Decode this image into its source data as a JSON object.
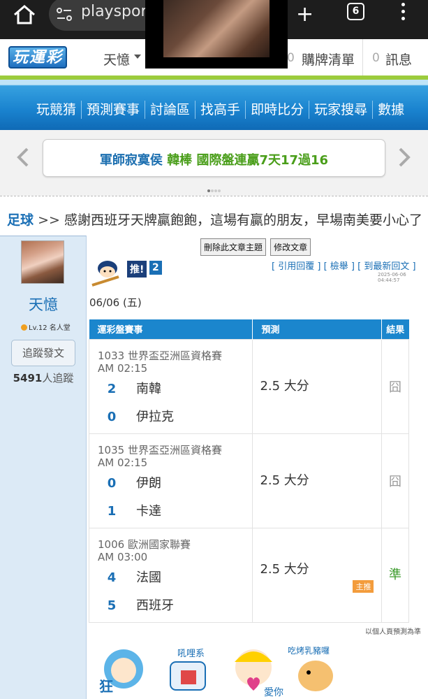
{
  "browser": {
    "url": "playsport",
    "tab_count": "6"
  },
  "header": {
    "logo": "玩運彩",
    "user": "天憶",
    "cart_count": "0",
    "cart_label": "購牌清單",
    "msg_count": "0",
    "msg_label": "訊息"
  },
  "nav": {
    "items": [
      "玩競猜",
      "預測賽事",
      "討論區",
      "找高手",
      "即時比分",
      "玩家搜尋",
      "數據"
    ]
  },
  "banner": {
    "text_a": "軍師寂寞侯",
    "text_b": "韓棒 國際盤連贏7天17過16"
  },
  "title": {
    "category": "足球",
    "separator": ">>",
    "text": "感謝西班牙天牌贏飽飽，這場有贏的朋友，早場南美要小心了"
  },
  "author": {
    "name": "天憶",
    "level": "Lv.12 名人堂",
    "follow_button": "追蹤發文",
    "followers_count": "5491",
    "followers_label": "人追蹤"
  },
  "post": {
    "delete_button": "刪除此文章主題",
    "edit_button": "修改文章",
    "push_label": "推!",
    "push_count": "2",
    "quote_link": "[ 引用回覆 ]",
    "report_link": "[ 檢舉 ]",
    "latest_link": "[ 到最新回文 ]",
    "time": "2025-06-06 04:44:57",
    "date": "06/06 (五)",
    "note": "以個人頁預測為準"
  },
  "table": {
    "headers": [
      "運彩盤賽事",
      "預測",
      "結果"
    ],
    "rows": [
      {
        "league": "1033 世界盃亞洲區資格賽",
        "time": "AM 02:15",
        "team_a_score": "2",
        "team_a": "南韓",
        "team_b_score": "0",
        "team_b": "伊拉克",
        "pick": "2.5 大分",
        "badge": "",
        "result": "囧",
        "result_color": "#999999"
      },
      {
        "league": "1035 世界盃亞洲區資格賽",
        "time": "AM 02:15",
        "team_a_score": "0",
        "team_a": "伊朗",
        "team_b_score": "1",
        "team_b": "卡達",
        "pick": "2.5 大分",
        "badge": "",
        "result": "囧",
        "result_color": "#999999"
      },
      {
        "league": "1006 歐洲國家聯賽",
        "time": "AM 03:00",
        "team_a_score": "4",
        "team_a": "法國",
        "team_b_score": "5",
        "team_b": "西班牙",
        "pick": "2.5 大分",
        "badge": "主推",
        "result": "準",
        "result_color": "#3a9a2a"
      }
    ]
  },
  "stickers": [
    "狂",
    "吼哩系",
    "愛你",
    "吃烤乳豬囉"
  ]
}
